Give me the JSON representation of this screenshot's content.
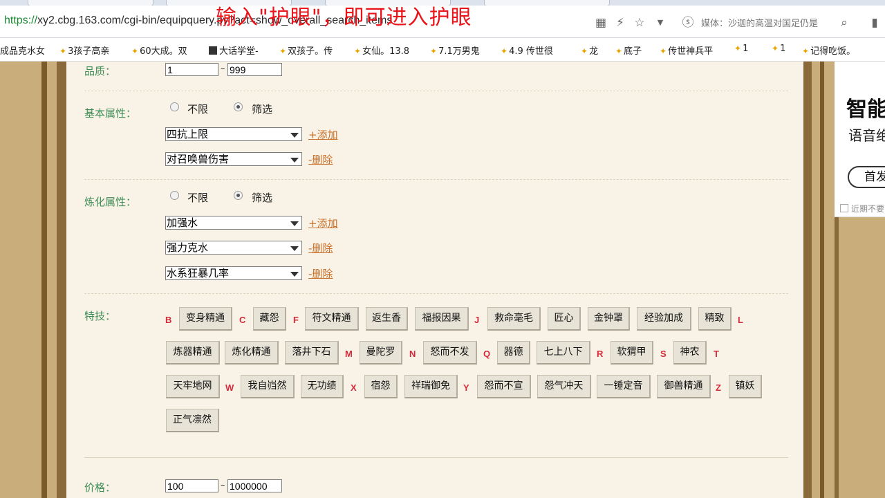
{
  "browser": {
    "url_scheme": "https://",
    "url_rest": "xy2.cbg.163.com/cgi-bin/equipquery.py?act=show_overall_search_items",
    "media_text": "媒体：沙迦的高温对国足仍是"
  },
  "overlay_caption": "输入\"护眼\"，即可进入护眼",
  "bookmarks": [
    {
      "label": "成品克水女",
      "icon": "none"
    },
    {
      "label": "3孩子高亲",
      "icon": "star"
    },
    {
      "label": "60大成。双",
      "icon": "star"
    },
    {
      "label": "大话学堂-",
      "icon": "cube"
    },
    {
      "label": "双孩子。传",
      "icon": "star"
    },
    {
      "label": "女仙。13.8",
      "icon": "star"
    },
    {
      "label": "7.1万男鬼",
      "icon": "star"
    },
    {
      "label": "4.9 传世很",
      "icon": "star"
    },
    {
      "label": "龙",
      "icon": "star"
    },
    {
      "label": "底子",
      "icon": "star"
    },
    {
      "label": "传世神兵平",
      "icon": "star"
    },
    {
      "label": "1",
      "icon": "star"
    },
    {
      "label": "1",
      "icon": "star"
    },
    {
      "label": "记得吃饭。",
      "icon": "star"
    }
  ],
  "form": {
    "quality": {
      "label": "品质：",
      "min": "1",
      "max": "999"
    },
    "basic": {
      "label": "基本属性：",
      "radio_none": "不限",
      "radio_filter": "筛选",
      "selects": [
        {
          "value": "四抗上限",
          "action": "+添加"
        },
        {
          "value": "对召唤兽伤害",
          "action": "-删除"
        }
      ]
    },
    "refine": {
      "label": "炼化属性：",
      "radio_none": "不限",
      "radio_filter": "筛选",
      "selects": [
        {
          "value": "加强水",
          "action": "+添加"
        },
        {
          "value": "强力克水",
          "action": "-删除"
        },
        {
          "value": "水系狂暴几率",
          "action": "-删除"
        }
      ]
    },
    "skills": {
      "label": "特技：",
      "letters": [
        "B",
        "C",
        "F",
        "J",
        "L",
        "M",
        "N",
        "Q",
        "R",
        "S",
        "T",
        "W",
        "X",
        "Y",
        "Z"
      ],
      "items": [
        "变身精通",
        "藏怨",
        "符文精通",
        "返生香",
        "福报因果",
        "救命毫毛",
        "匠心",
        "金钟罩",
        "经验加成",
        "精致",
        "炼器精通",
        "炼化精通",
        "落井下石",
        "曼陀罗",
        "怒而不发",
        "器德",
        "七上八下",
        "软猬甲",
        "神农",
        "天牢地网",
        "我自岿然",
        "无功绩",
        "宿怨",
        "祥瑞御免",
        "怨而不宣",
        "怨气冲天",
        "一锤定音",
        "御兽精通",
        "镇妖",
        "正气凛然"
      ]
    },
    "price": {
      "label": "价格：",
      "min": "100",
      "max": "1000000"
    }
  },
  "ad": {
    "title": "智能",
    "subtitle": "语音绝",
    "button": "首发",
    "checkbox": "近期不要"
  }
}
